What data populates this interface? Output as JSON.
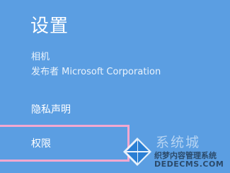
{
  "settings": {
    "title": "设置",
    "app_name": "相机",
    "publisher": "发布者 Microsoft Corporation",
    "items": [
      {
        "label": "隐私声明"
      },
      {
        "label": "权限"
      }
    ]
  },
  "watermark": {
    "brand": "系统城",
    "cn_text": "织梦内容管理系统",
    "en_text": "DEDECMS.COM"
  },
  "colors": {
    "panel_bg": "#5b9ee2",
    "highlight": "#f3a8d0",
    "text": "#ffffff"
  }
}
